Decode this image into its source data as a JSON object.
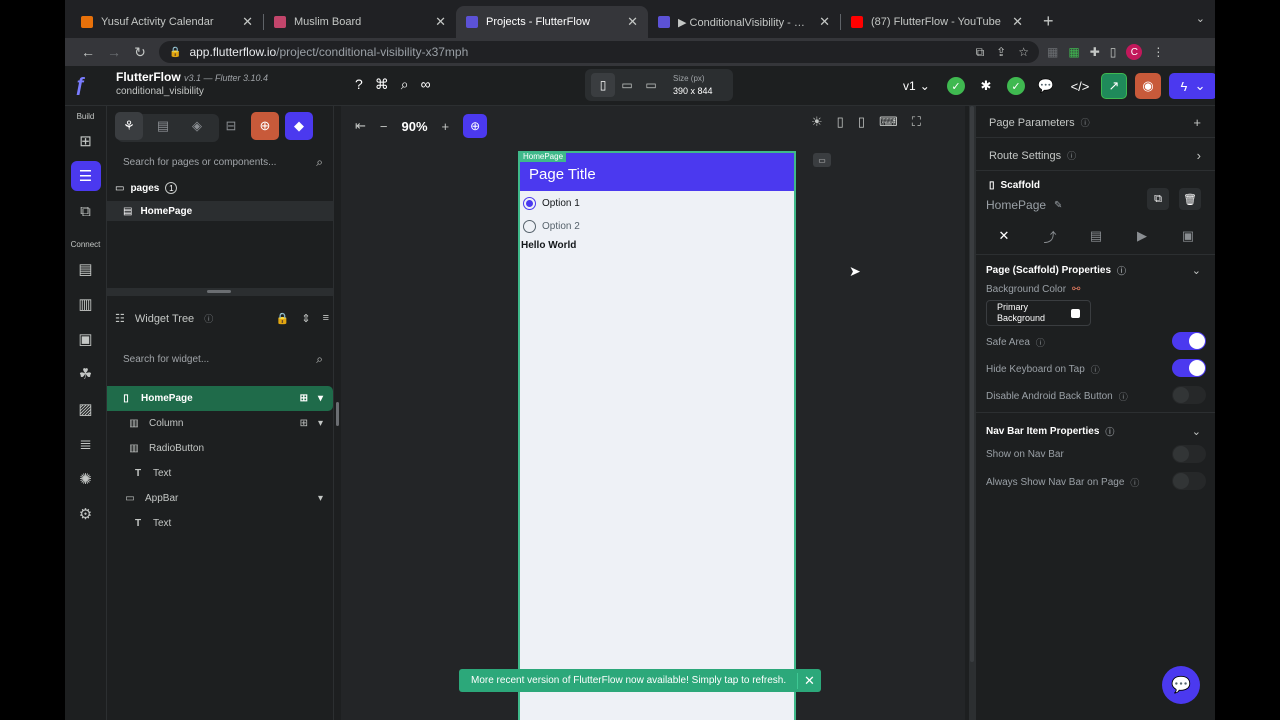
{
  "browser": {
    "tabs": [
      {
        "title": "Yusuf Activity Calendar",
        "color": "#e8710a",
        "active": false
      },
      {
        "title": "Muslim Board",
        "color": "#c2456b",
        "active": false
      },
      {
        "title": "Projects - FlutterFlow",
        "color": "#5c52d6",
        "active": true
      },
      {
        "title": "▶ ConditionalVisibility - Flutterflow",
        "color": "#5c52d6",
        "active": false
      },
      {
        "title": "(87) FlutterFlow - YouTube",
        "color": "#ff0000",
        "active": false
      }
    ],
    "url_host": "app.flutterflow.io",
    "url_path": "/project/conditional-visibility-x37mph",
    "profile_initial": "C"
  },
  "app": {
    "brand": "FlutterFlow",
    "version": "v3.1 — Flutter 3.10.4",
    "project": "conditional_visibility",
    "size_label": "Size (px)",
    "size_value": "390 x 844",
    "branch": "v1"
  },
  "rail": {
    "build_label": "Build",
    "connect_label": "Connect"
  },
  "page_nav": {
    "search_placeholder": "Search for pages or components...",
    "pages_label": "pages",
    "pages_count": "1",
    "page_item": "HomePage",
    "widget_tree_title": "Widget Tree",
    "widget_search_placeholder": "Search for widget...",
    "tree": [
      {
        "label": "HomePage",
        "icon": "phone-icon",
        "depth": 0,
        "selected": true
      },
      {
        "label": "Column",
        "icon": "column-icon",
        "depth": 1,
        "selected": false
      },
      {
        "label": "RadioButton",
        "icon": "radio-icon",
        "depth": 2,
        "selected": false
      },
      {
        "label": "Text",
        "icon": "text-icon",
        "depth": 1,
        "selected": false
      },
      {
        "label": "AppBar",
        "icon": "appbar-icon",
        "depth": 1,
        "selected": false
      },
      {
        "label": "Text",
        "icon": "text-icon",
        "depth": 1,
        "selected": false
      }
    ]
  },
  "canvas": {
    "zoom": "90%",
    "page_tag": "HomePage",
    "page_title": "Page Title",
    "option1": "Option 1",
    "option2": "Option 2",
    "hello": "Hello World",
    "toast": "More recent version of FlutterFlow now available! Simply tap to refresh."
  },
  "props": {
    "page_parameters": "Page Parameters",
    "route_settings": "Route Settings",
    "widget_type": "Scaffold",
    "widget_name": "HomePage",
    "section_title": "Page (Scaffold) Properties",
    "bg_color_label": "Background Color",
    "bg_color_value": "Primary Background",
    "safe_area": "Safe Area",
    "safe_area_on": true,
    "hide_keyboard": "Hide Keyboard on Tap",
    "hide_keyboard_on": true,
    "disable_back": "Disable Android Back Button",
    "disable_back_on": false,
    "nav_section": "Nav Bar Item Properties",
    "show_nav": "Show on Nav Bar",
    "show_nav_on": false,
    "always_nav": "Always Show Nav Bar on Page",
    "always_nav_on": false
  }
}
